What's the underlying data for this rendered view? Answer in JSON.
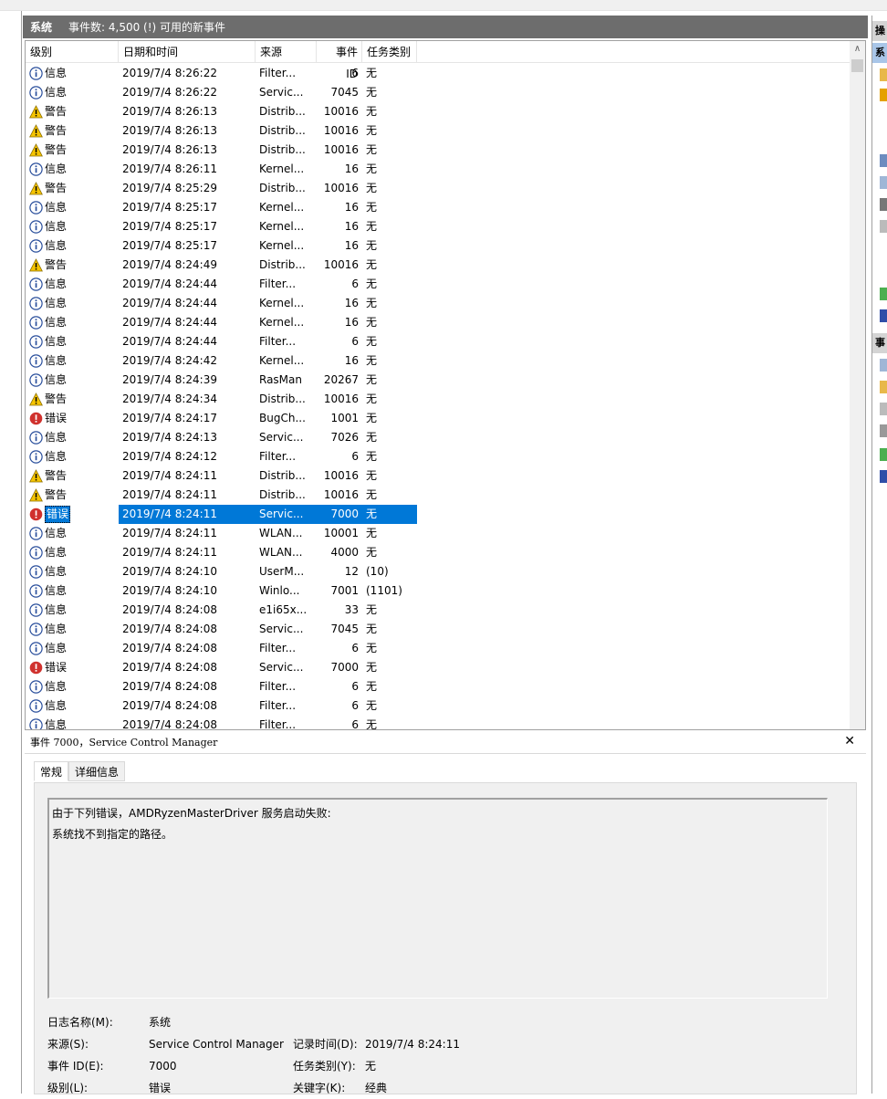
{
  "header": {
    "log_name": "系统",
    "event_count": "事件数: 4,500 (!) 可用的新事件"
  },
  "columns": [
    "级别",
    "日期和时间",
    "来源",
    "事件 ID",
    "任务类别"
  ],
  "rows": [
    {
      "level": "info",
      "label": "信息",
      "date": "2019/7/4 8:26:22",
      "source": "Filter...",
      "id": "6",
      "task": "无"
    },
    {
      "level": "info",
      "label": "信息",
      "date": "2019/7/4 8:26:22",
      "source": "Servic...",
      "id": "7045",
      "task": "无"
    },
    {
      "level": "warn",
      "label": "警告",
      "date": "2019/7/4 8:26:13",
      "source": "Distrib...",
      "id": "10016",
      "task": "无"
    },
    {
      "level": "warn",
      "label": "警告",
      "date": "2019/7/4 8:26:13",
      "source": "Distrib...",
      "id": "10016",
      "task": "无"
    },
    {
      "level": "warn",
      "label": "警告",
      "date": "2019/7/4 8:26:13",
      "source": "Distrib...",
      "id": "10016",
      "task": "无"
    },
    {
      "level": "info",
      "label": "信息",
      "date": "2019/7/4 8:26:11",
      "source": "Kernel...",
      "id": "16",
      "task": "无"
    },
    {
      "level": "warn",
      "label": "警告",
      "date": "2019/7/4 8:25:29",
      "source": "Distrib...",
      "id": "10016",
      "task": "无"
    },
    {
      "level": "info",
      "label": "信息",
      "date": "2019/7/4 8:25:17",
      "source": "Kernel...",
      "id": "16",
      "task": "无"
    },
    {
      "level": "info",
      "label": "信息",
      "date": "2019/7/4 8:25:17",
      "source": "Kernel...",
      "id": "16",
      "task": "无"
    },
    {
      "level": "info",
      "label": "信息",
      "date": "2019/7/4 8:25:17",
      "source": "Kernel...",
      "id": "16",
      "task": "无"
    },
    {
      "level": "warn",
      "label": "警告",
      "date": "2019/7/4 8:24:49",
      "source": "Distrib...",
      "id": "10016",
      "task": "无"
    },
    {
      "level": "info",
      "label": "信息",
      "date": "2019/7/4 8:24:44",
      "source": "Filter...",
      "id": "6",
      "task": "无"
    },
    {
      "level": "info",
      "label": "信息",
      "date": "2019/7/4 8:24:44",
      "source": "Kernel...",
      "id": "16",
      "task": "无"
    },
    {
      "level": "info",
      "label": "信息",
      "date": "2019/7/4 8:24:44",
      "source": "Kernel...",
      "id": "16",
      "task": "无"
    },
    {
      "level": "info",
      "label": "信息",
      "date": "2019/7/4 8:24:44",
      "source": "Filter...",
      "id": "6",
      "task": "无"
    },
    {
      "level": "info",
      "label": "信息",
      "date": "2019/7/4 8:24:42",
      "source": "Kernel...",
      "id": "16",
      "task": "无"
    },
    {
      "level": "info",
      "label": "信息",
      "date": "2019/7/4 8:24:39",
      "source": "RasMan",
      "id": "20267",
      "task": "无"
    },
    {
      "level": "warn",
      "label": "警告",
      "date": "2019/7/4 8:24:34",
      "source": "Distrib...",
      "id": "10016",
      "task": "无"
    },
    {
      "level": "error",
      "label": "错误",
      "date": "2019/7/4 8:24:17",
      "source": "BugCh...",
      "id": "1001",
      "task": "无"
    },
    {
      "level": "info",
      "label": "信息",
      "date": "2019/7/4 8:24:13",
      "source": "Servic...",
      "id": "7026",
      "task": "无"
    },
    {
      "level": "info",
      "label": "信息",
      "date": "2019/7/4 8:24:12",
      "source": "Filter...",
      "id": "6",
      "task": "无"
    },
    {
      "level": "warn",
      "label": "警告",
      "date": "2019/7/4 8:24:11",
      "source": "Distrib...",
      "id": "10016",
      "task": "无"
    },
    {
      "level": "warn",
      "label": "警告",
      "date": "2019/7/4 8:24:11",
      "source": "Distrib...",
      "id": "10016",
      "task": "无"
    },
    {
      "level": "error",
      "label": "错误",
      "date": "2019/7/4 8:24:11",
      "source": "Servic...",
      "id": "7000",
      "task": "无",
      "selected": true
    },
    {
      "level": "info",
      "label": "信息",
      "date": "2019/7/4 8:24:11",
      "source": "WLAN...",
      "id": "10001",
      "task": "无"
    },
    {
      "level": "info",
      "label": "信息",
      "date": "2019/7/4 8:24:11",
      "source": "WLAN...",
      "id": "4000",
      "task": "无"
    },
    {
      "level": "info",
      "label": "信息",
      "date": "2019/7/4 8:24:10",
      "source": "UserM...",
      "id": "12",
      "task": "(10)"
    },
    {
      "level": "info",
      "label": "信息",
      "date": "2019/7/4 8:24:10",
      "source": "Winlo...",
      "id": "7001",
      "task": "(1101)"
    },
    {
      "level": "info",
      "label": "信息",
      "date": "2019/7/4 8:24:08",
      "source": "e1i65x...",
      "id": "33",
      "task": "无"
    },
    {
      "level": "info",
      "label": "信息",
      "date": "2019/7/4 8:24:08",
      "source": "Servic...",
      "id": "7045",
      "task": "无"
    },
    {
      "level": "info",
      "label": "信息",
      "date": "2019/7/4 8:24:08",
      "source": "Filter...",
      "id": "6",
      "task": "无"
    },
    {
      "level": "error",
      "label": "错误",
      "date": "2019/7/4 8:24:08",
      "source": "Servic...",
      "id": "7000",
      "task": "无"
    },
    {
      "level": "info",
      "label": "信息",
      "date": "2019/7/4 8:24:08",
      "source": "Filter...",
      "id": "6",
      "task": "无"
    },
    {
      "level": "info",
      "label": "信息",
      "date": "2019/7/4 8:24:08",
      "source": "Filter...",
      "id": "6",
      "task": "无"
    },
    {
      "level": "info",
      "label": "信息",
      "date": "2019/7/4 8:24:08",
      "source": "Filter...",
      "id": "6",
      "task": "无"
    }
  ],
  "detail": {
    "title": "事件 7000，Service Control Manager",
    "tabs": [
      "常规",
      "详细信息"
    ],
    "message_line1": "由于下列错误，AMDRyzenMasterDriver 服务启动失败:",
    "message_line2": "系统找不到指定的路径。",
    "fields": {
      "log_name_label": "日志名称(M):",
      "log_name_value": "系统",
      "source_label": "来源(S):",
      "source_value": "Service Control Manager",
      "logged_label": "记录时间(D):",
      "logged_value": "2019/7/4 8:24:11",
      "event_id_label": "事件 ID(E):",
      "event_id_value": "7000",
      "task_label": "任务类别(Y):",
      "task_value": "无",
      "level_label": "级别(L):",
      "level_value": "错误",
      "keywords_label": "关键字(K):",
      "keywords_value": "经典"
    }
  },
  "actions_pane": {
    "header1": "操",
    "header2": "系",
    "header3": "事"
  },
  "colors": {
    "selection": "#0078d7",
    "title_bar": "#6d6d6d",
    "error": "#d0312d",
    "warning": "#f5c400",
    "info": "#2a4f9c"
  }
}
